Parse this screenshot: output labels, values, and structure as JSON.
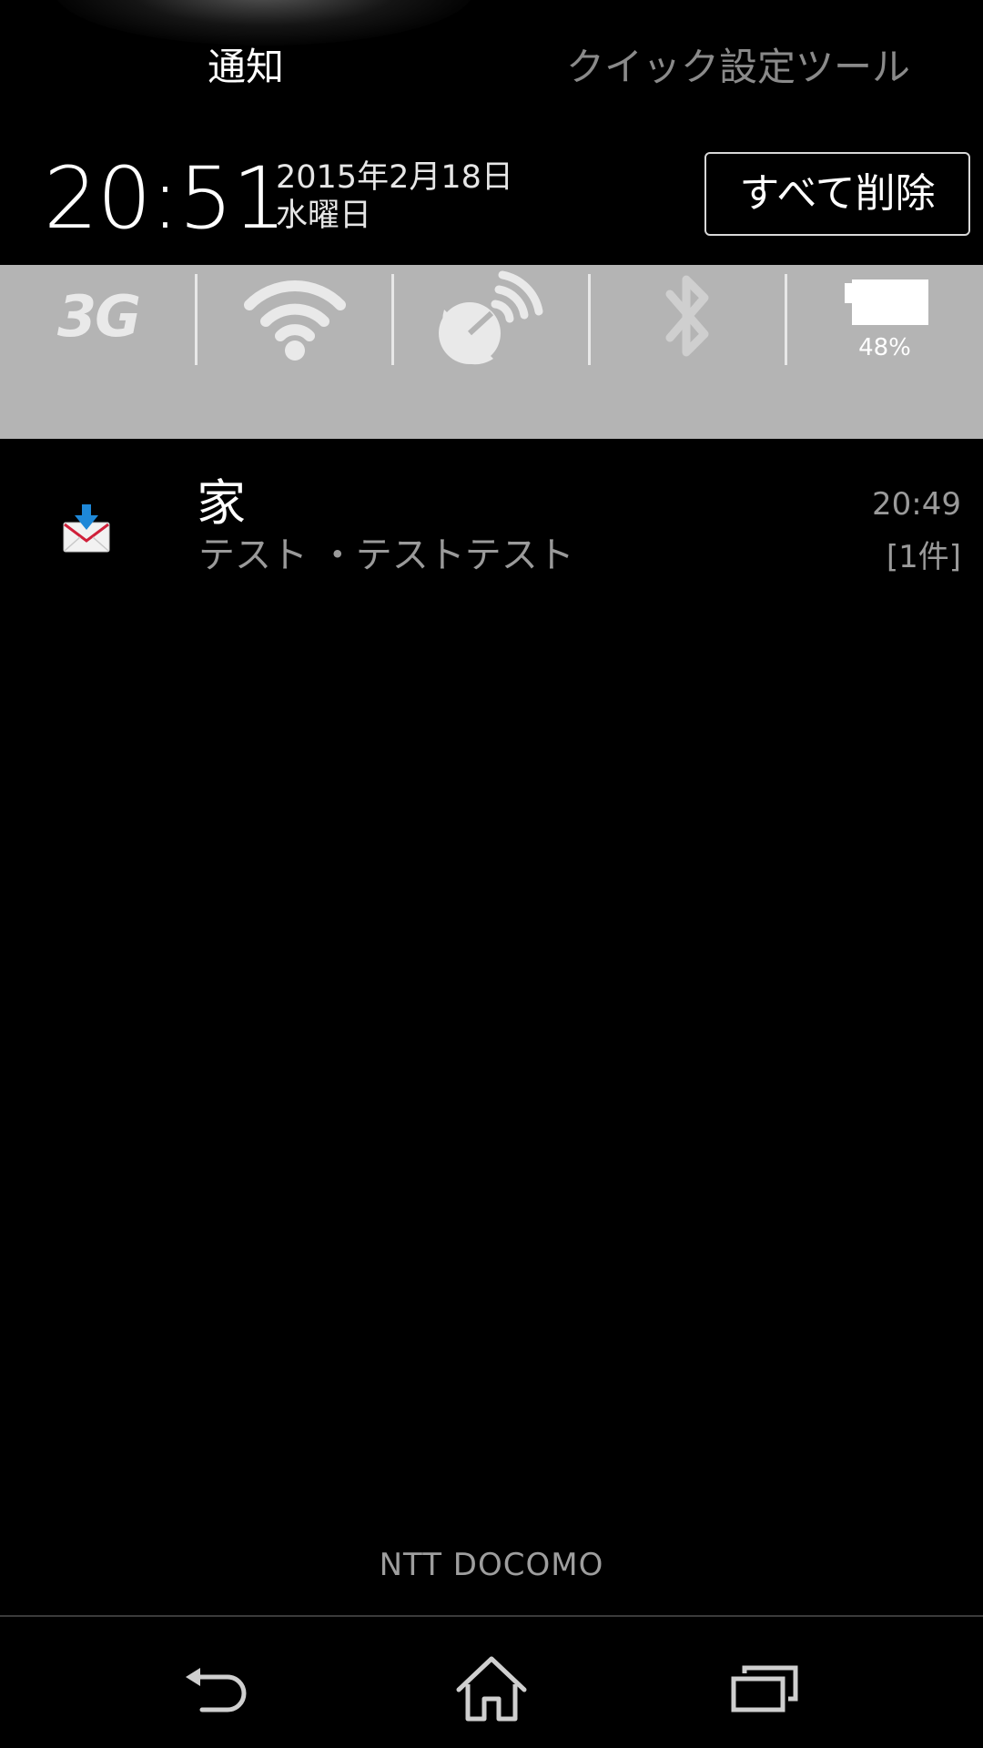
{
  "tabs": {
    "notifications": "通知",
    "quick_settings": "クイック設定ツール"
  },
  "header": {
    "time": "20:51",
    "date": "2015年2月18日",
    "weekday": "水曜日",
    "clear_all_label": "すべて削除"
  },
  "quick_settings": {
    "items": [
      {
        "icon": "mobile-data-3g-icon",
        "label": "3G"
      },
      {
        "icon": "wifi-icon"
      },
      {
        "icon": "gps-icon"
      },
      {
        "icon": "bluetooth-icon"
      },
      {
        "icon": "battery-icon",
        "level_percent": 48,
        "label": "48%"
      }
    ],
    "bar_color": "#b4b4b4",
    "icon_color": "#e9e9e9"
  },
  "notifications": [
    {
      "icon": "mail-download-icon",
      "title": "家",
      "body": "テスト ・テストテスト",
      "time": "20:49",
      "count": "[1件]"
    }
  ],
  "footer": {
    "carrier": "NTT DOCOMO"
  },
  "navbar": {
    "buttons": [
      "back-icon",
      "home-icon",
      "recent-apps-icon"
    ]
  }
}
